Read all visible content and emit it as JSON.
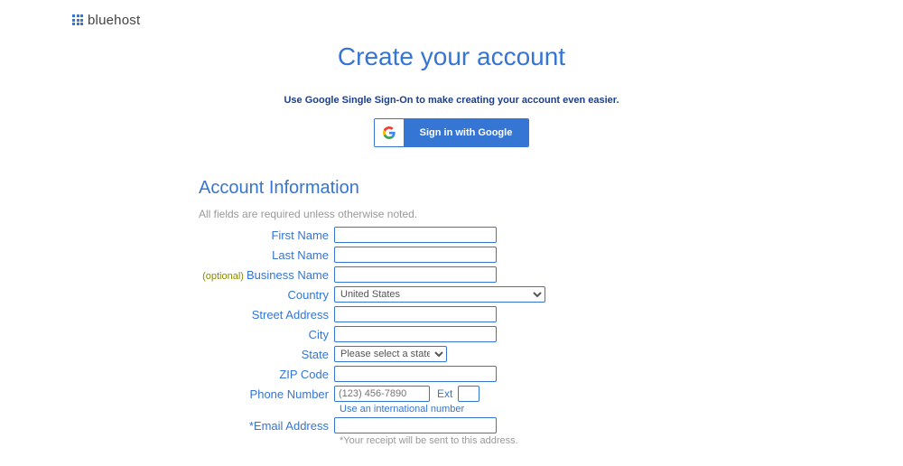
{
  "brand": {
    "name": "bluehost"
  },
  "page": {
    "title": "Create your account",
    "sso_msg": "Use Google Single Sign-On to make creating your account even easier.",
    "google_btn_label": "Sign in with Google"
  },
  "section": {
    "title": "Account Information",
    "helper": "All fields are required unless otherwise noted."
  },
  "labels": {
    "first_name": "First Name",
    "last_name": "Last Name",
    "business_name": "Business Name",
    "optional": "(optional)",
    "country": "Country",
    "street": "Street Address",
    "city": "City",
    "state": "State",
    "zip": "ZIP Code",
    "phone": "Phone Number",
    "ext": "Ext",
    "email": "*Email Address"
  },
  "values": {
    "country_selected": "United States",
    "state_placeholder": "Please select a state",
    "phone_placeholder": "(123) 456-7890"
  },
  "notes": {
    "intl": "Use an international number",
    "receipt": "*Your receipt will be sent to this address."
  }
}
